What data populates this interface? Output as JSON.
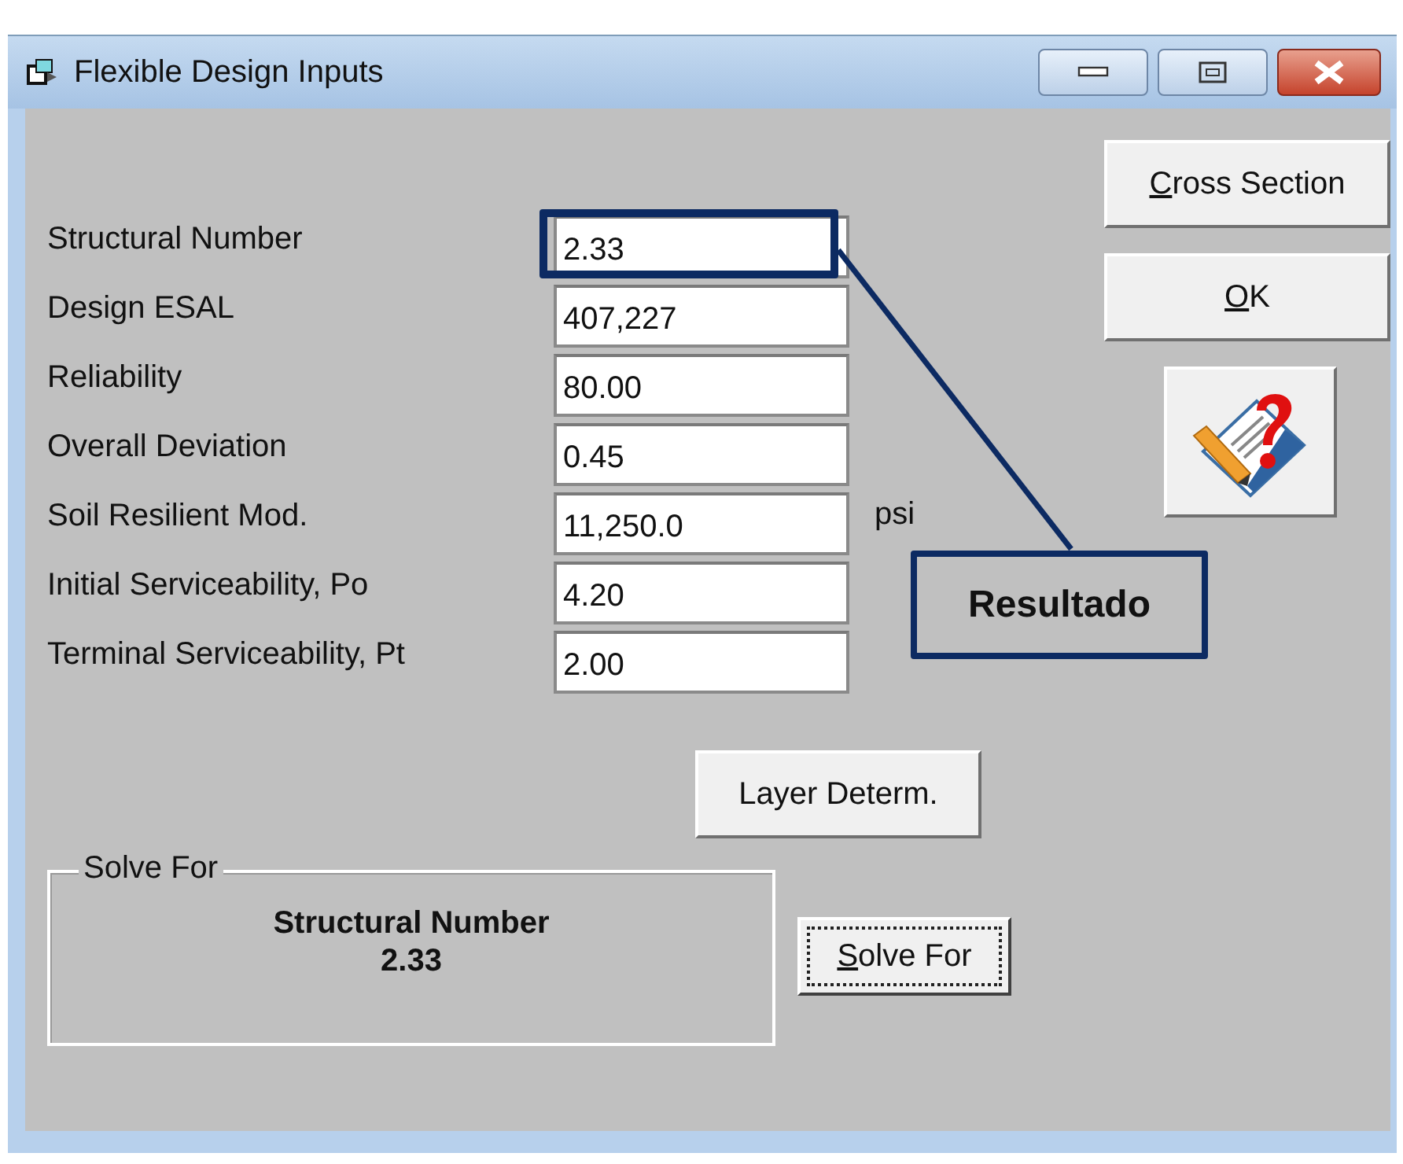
{
  "window": {
    "title": "Flexible Design Inputs"
  },
  "window_buttons": [
    {
      "kind": "minimize"
    },
    {
      "kind": "maximize"
    },
    {
      "kind": "close"
    }
  ],
  "fields": [
    {
      "label": "Structural Number",
      "value": "2.33",
      "highlighted": true
    },
    {
      "label": "Design ESAL",
      "value": "407,227",
      "highlighted": false
    },
    {
      "label": "Reliability",
      "value": "80.00",
      "highlighted": false
    },
    {
      "label": "Overall Deviation",
      "value": "0.45",
      "highlighted": false
    },
    {
      "label": "Soil Resilient Mod.",
      "value": "11,250.0",
      "unit": "psi",
      "highlighted": false
    },
    {
      "label": "Initial Serviceability, Po",
      "value": "4.20",
      "highlighted": false
    },
    {
      "label": "Terminal Serviceability, Pt",
      "value": "2.00",
      "highlighted": false
    }
  ],
  "side_buttons": [
    {
      "kind": "text",
      "label": "Cross Section",
      "mnemonic": true
    },
    {
      "kind": "text",
      "label": "OK",
      "mnemonic": true
    },
    {
      "kind": "help"
    }
  ],
  "layer_button": {
    "label": "Layer Determ."
  },
  "solve_group": {
    "title": "Solve For",
    "result_label": "Structural Number",
    "result_value": "2.33"
  },
  "solve_button": {
    "label": "Solve For",
    "mnemonic": true,
    "focused": true
  },
  "callout": {
    "text": "Resultado"
  }
}
